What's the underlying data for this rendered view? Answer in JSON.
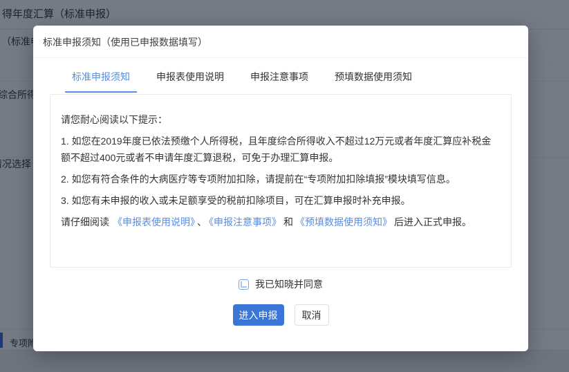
{
  "colors": {
    "accent": "#568ce4",
    "primary": "#3b76d6"
  },
  "background": {
    "page_title": "得年度汇算（标准申报）",
    "partials": {
      "row1": "（标准申",
      "row2": "综合所得",
      "row3": "情况选择",
      "bottom_tab": "专项附"
    }
  },
  "modal": {
    "title": "标准申报须知（使用已申报数据填写）",
    "tabs": [
      {
        "label": "标准申报须知"
      },
      {
        "label": "申报表使用说明"
      },
      {
        "label": "申报注意事项"
      },
      {
        "label": "预填数据使用须知"
      }
    ],
    "notice": {
      "intro": "请您耐心阅读以下提示：",
      "items": [
        "1. 如您在2019年度已依法预缴个人所得税，且年度综合所得收入不超过12万元或者年度汇算应补税金额不超过400元或者不申请年度汇算退税，可免于办理汇算申报。",
        "2. 如您有符合条件的大病医疗等专项附加扣除，请提前在“专项附加扣除填报”模块填写信息。",
        "3. 如您有未申报的收入或未足额享受的税前扣除项目，可在汇算申报时补充申报。"
      ],
      "footer": {
        "prefix": "请仔细阅读",
        "link1": "《申报表使用说明》",
        "sep1": "、",
        "link2": "《申报注意事项》",
        "sep2": "和",
        "link3": "《预填数据使用须知》",
        "suffix": "后进入正式申报。"
      }
    },
    "agree_label": "我已知晓并同意",
    "buttons": {
      "confirm": "进入申报",
      "cancel": "取消"
    }
  }
}
